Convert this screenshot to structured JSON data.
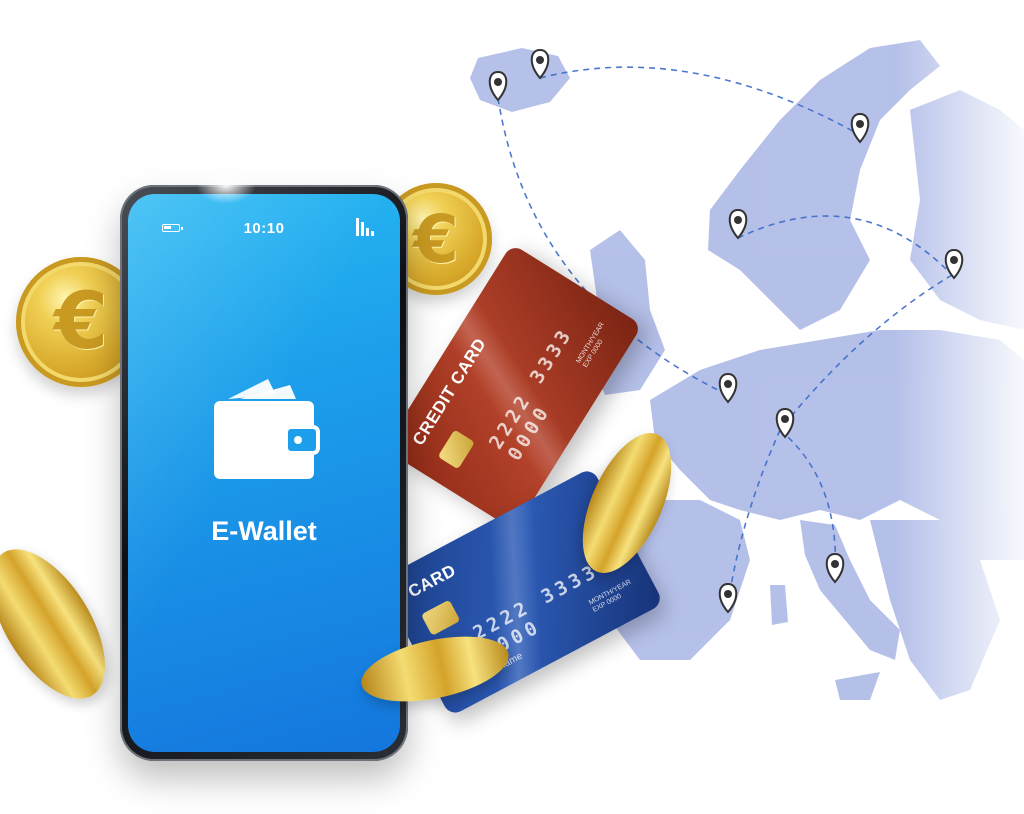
{
  "phone": {
    "status_time": "10:10",
    "app_title": "E-Wallet",
    "battery_icon": "battery-icon",
    "signal_icon": "signal-icon",
    "wallet_icon": "wallet-icon"
  },
  "cards": {
    "red": {
      "label": "CREDIT CARD",
      "number": "2222 3333 0000",
      "expiry": "MONTH/YEAR\nEXP 0000"
    },
    "blue": {
      "label": "CARD",
      "number": "2222 3333 0000",
      "expiry": "MONTH/YEAR\nEXP 0000",
      "name": "Name Surname"
    }
  },
  "coins": {
    "symbol": "€"
  },
  "map": {
    "region": "Europe",
    "pin_icon": "map-pin-icon"
  },
  "colors": {
    "screen_top": "#27b8f3",
    "screen_bottom": "#1476dd",
    "map_fill": "#a9b6e6",
    "route_line": "#3c6bc7",
    "coin_gold": "#d8a92a",
    "card_red": "#8f2a16",
    "card_blue": "#1c3f8a"
  }
}
